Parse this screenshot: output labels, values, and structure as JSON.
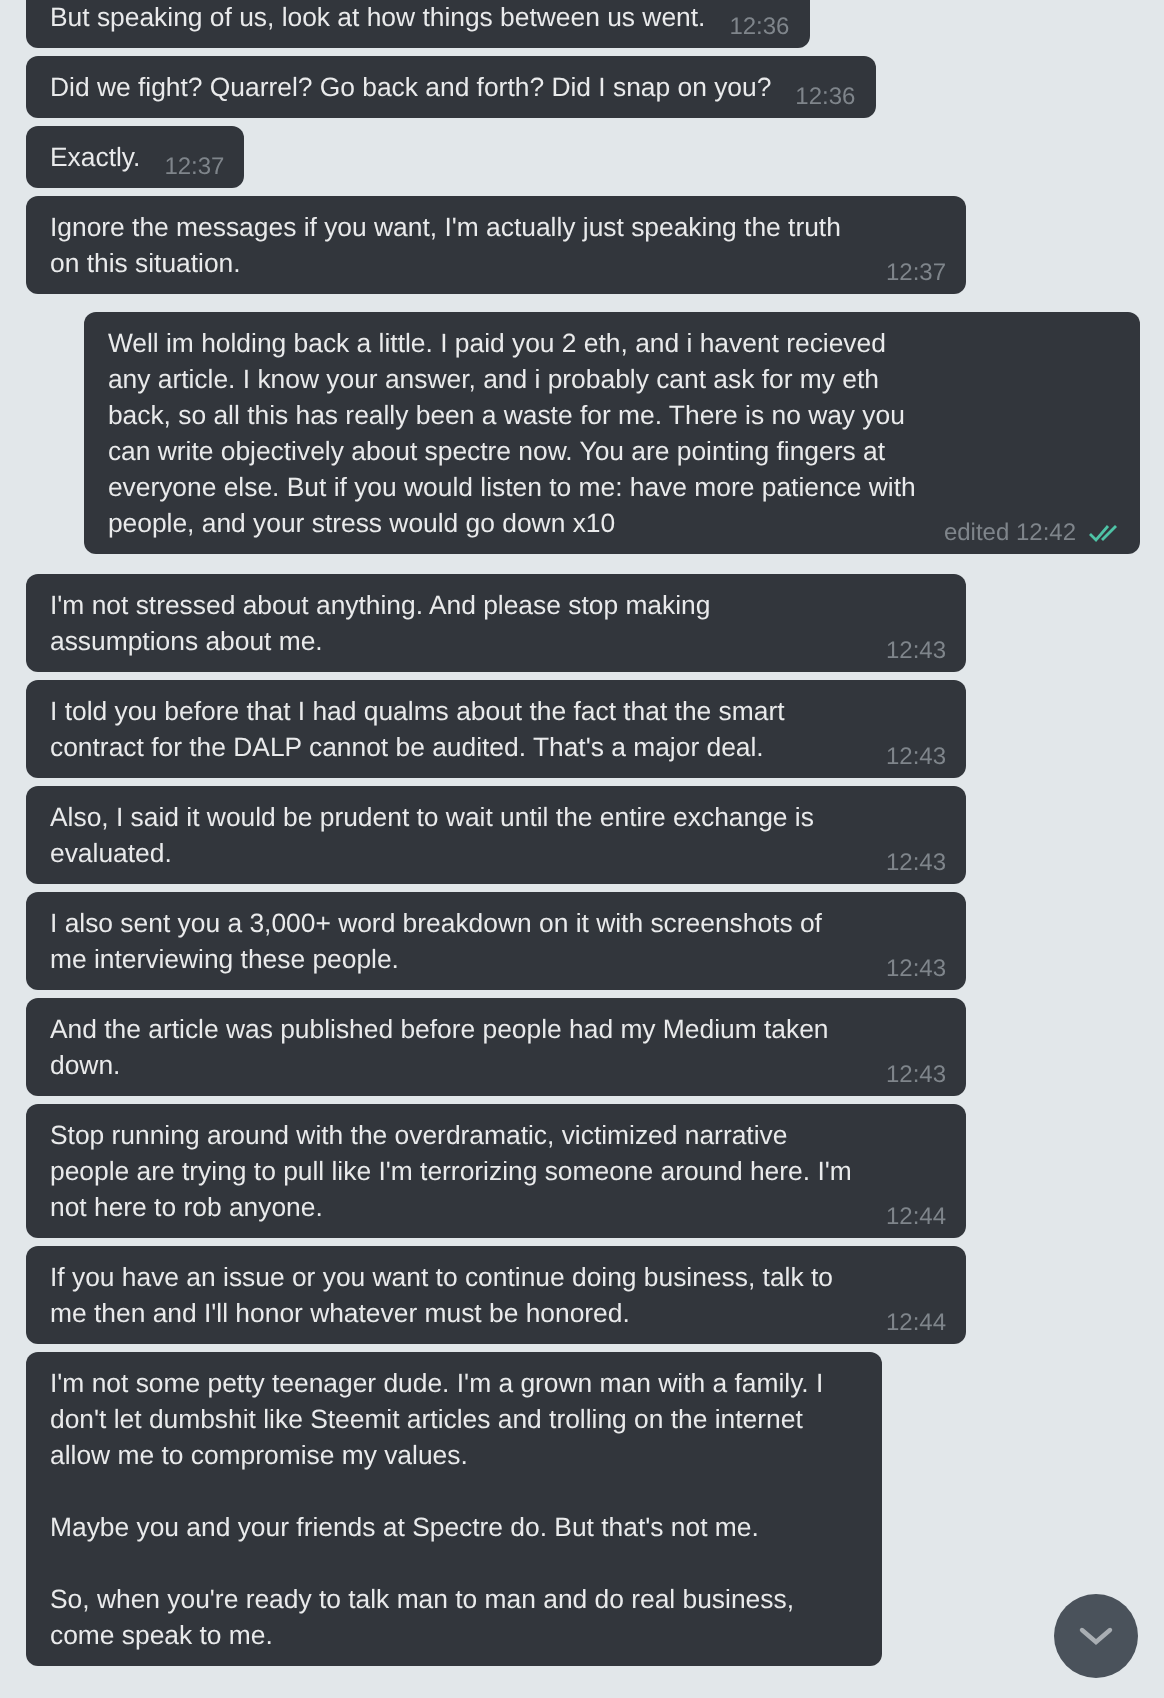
{
  "messages": [
    {
      "kind": "incoming",
      "text": "But speaking of us, look at how things between us went.",
      "time": "12:36"
    },
    {
      "kind": "incoming",
      "text": "Did we fight? Quarrel? Go back and forth? Did I snap on you?",
      "time": "12:36"
    },
    {
      "kind": "incoming",
      "text": "Exactly.",
      "time": "12:37"
    },
    {
      "kind": "incoming",
      "text": "Ignore the messages if you want, I'm actually just speaking the truth on this situation.",
      "time": "12:37"
    },
    {
      "kind": "outgoing",
      "text": "Well im holding back a little. I paid you 2 eth, and i havent recieved any article. I know your answer, and i probably cant ask for my eth back, so all this has really been a waste for me. There is no way you can write objectively about spectre now. You are pointing fingers at everyone else. But if you would listen to me: have more patience with people, and your stress would go down x10",
      "time": "edited 12:42",
      "read": true
    },
    {
      "kind": "incoming",
      "text": "I'm not stressed about anything. And please stop making assumptions about me.",
      "time": "12:43"
    },
    {
      "kind": "incoming",
      "text": "I told you before that I had qualms about the fact that the smart contract for the DALP cannot be audited. That's a major deal.",
      "time": "12:43"
    },
    {
      "kind": "incoming",
      "text": "Also, I said it would be prudent to wait until the entire exchange is evaluated.",
      "time": "12:43"
    },
    {
      "kind": "incoming",
      "text": "I also sent you a 3,000+ word breakdown on it with screenshots of me interviewing these people.",
      "time": "12:43"
    },
    {
      "kind": "incoming",
      "text": "And the article was published before people had my Medium taken down.",
      "time": "12:43"
    },
    {
      "kind": "incoming",
      "text": "Stop running around with the overdramatic, victimized narrative people are trying to pull like I'm terrorizing someone around here. I'm not here to rob anyone.",
      "time": "12:44"
    },
    {
      "kind": "incoming",
      "text": "If you have an issue or you want to continue doing business, talk to me then and I'll honor whatever must be honored.",
      "time": "12:44"
    },
    {
      "kind": "incoming",
      "text": "I'm not some petty teenager dude. I'm a grown man with a family. I don't let dumbshit like Steemit articles and trolling on the internet allow me to compromise my values.\n\nMaybe you and your friends at Spectre do. But that's not me.\n\nSo, when you're ready to talk man to man and do real business, come speak to me."
    }
  ]
}
